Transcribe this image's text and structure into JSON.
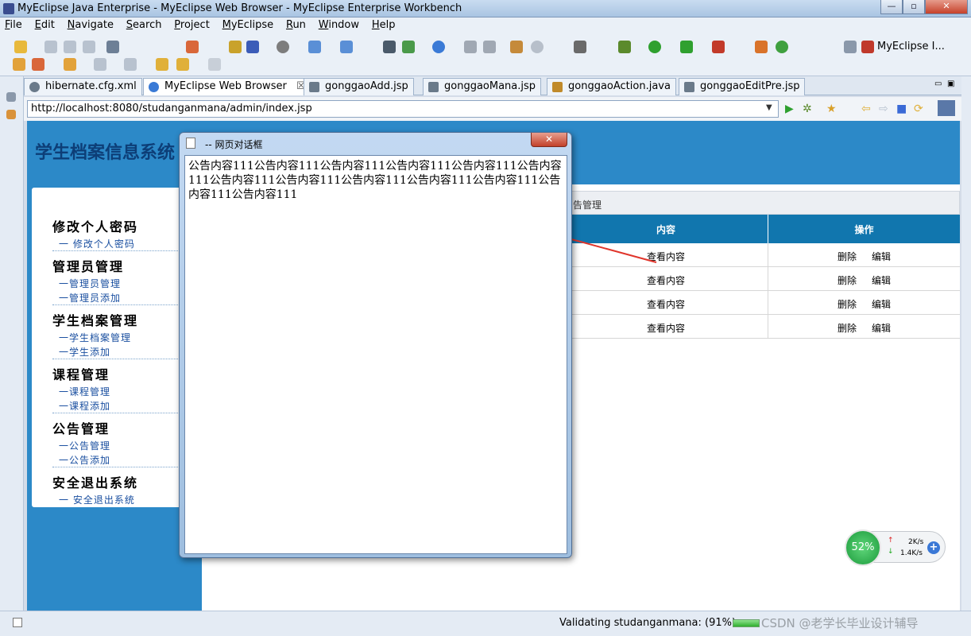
{
  "window": {
    "title": "MyEclipse Java Enterprise - MyEclipse Web Browser - MyEclipse Enterprise Workbench",
    "min": "—",
    "max": "▫",
    "close": "✕"
  },
  "menu": [
    "File",
    "Edit",
    "Navigate",
    "Search",
    "Project",
    "MyEclipse",
    "Run",
    "Window",
    "Help"
  ],
  "toolbar": {
    "perspective": "MyEclipse I..."
  },
  "tabs": [
    {
      "label": "hibernate.cfg.xml",
      "icon": "xml-file-icon"
    },
    {
      "label": "MyEclipse Web Browser",
      "icon": "browser-icon",
      "close": "☒"
    },
    {
      "label": "gonggaoAdd.jsp",
      "icon": "jsp-file-icon"
    },
    {
      "label": "gonggaoMana.jsp",
      "icon": "jsp-file-icon"
    },
    {
      "label": "gonggaoAction.java",
      "icon": "java-file-icon"
    },
    {
      "label": "gonggaoEditPre.jsp",
      "icon": "jsp-file-icon"
    }
  ],
  "browser": {
    "url": "http://localhost:8080/studanganmana/admin/index.jsp"
  },
  "page": {
    "site_title": "学生档案信息系统",
    "sidebar": [
      {
        "title": "修改个人密码",
        "items": [
          "一 修改个人密码"
        ]
      },
      {
        "title": "管理员管理",
        "items": [
          "一管理员管理",
          "一管理员添加"
        ]
      },
      {
        "title": "学生档案管理",
        "items": [
          "一学生档案管理",
          "一学生添加"
        ]
      },
      {
        "title": "课程管理",
        "items": [
          "一课程管理",
          "一课程添加"
        ]
      },
      {
        "title": "公告管理",
        "items": [
          "一公告管理",
          "一公告添加"
        ]
      },
      {
        "title": "安全退出系统",
        "items": [
          "一 安全退出系统"
        ]
      }
    ],
    "breadcrumb": "告管理",
    "table": {
      "headers": [
        "内容",
        "操作"
      ],
      "rows": [
        {
          "content": "查看内容",
          "delete": "删除",
          "edit": "编辑"
        },
        {
          "content": "查看内容",
          "delete": "删除",
          "edit": "编辑"
        },
        {
          "content": "查看内容",
          "delete": "删除",
          "edit": "编辑"
        },
        {
          "content": "查看内容",
          "delete": "删除",
          "edit": "编辑"
        }
      ]
    }
  },
  "dialog": {
    "title": "-- 网页对话框",
    "close": "✕",
    "body": "公告内容111公告内容111公告内容111公告内容111公告内容111公告内容111公告内容111公告内容111公告内容111公告内容111公告内容111公告内容111公告内容111"
  },
  "widget": {
    "cpu": "52%",
    "up": "2K/s",
    "down": "1.4K/s",
    "add": "+"
  },
  "status": {
    "text": "Validating studanganmana: (91%)",
    "watermark": "CSDN @老学长毕业设计辅导"
  },
  "colors": {
    "accent": "#2c89c8",
    "table_header": "#1176ae",
    "arrow": "#e0352b"
  }
}
